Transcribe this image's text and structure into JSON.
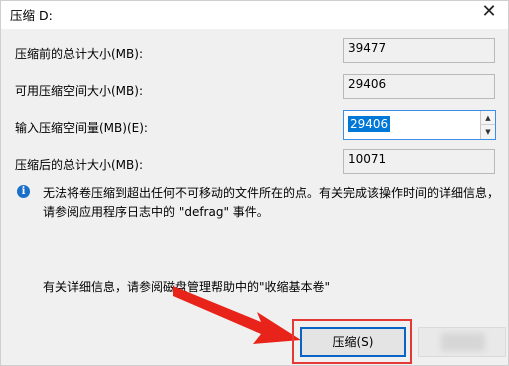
{
  "window": {
    "title": "压缩 D:",
    "close_glyph": "✕"
  },
  "fields": {
    "total_before": {
      "label": "压缩前的总计大小(MB):",
      "value": "39477"
    },
    "available": {
      "label": "可用压缩空间大小(MB):",
      "value": "29406"
    },
    "amount": {
      "label": "输入压缩空间量(MB)(E):",
      "value": "29406",
      "up_glyph": "▲",
      "down_glyph": "▼"
    },
    "total_after": {
      "label": "压缩后的总计大小(MB):",
      "value": "10071"
    }
  },
  "info": {
    "icon_glyph": "i",
    "icon_name": "info-icon",
    "icon_color": "#1a6fc9",
    "text": "无法将卷压缩到超出任何不可移动的文件所在的点。有关完成该操作时间的详细信息，请参阅应用程序日志中的 \"defrag\" 事件。"
  },
  "detail_text": "有关详细信息，请参阅磁盘管理帮助中的\"收缩基本卷\"",
  "buttons": {
    "shrink_label": "压缩(S)"
  },
  "annotation": {
    "highlight_color": "#e53935",
    "arrow_color": "#e8231a"
  }
}
